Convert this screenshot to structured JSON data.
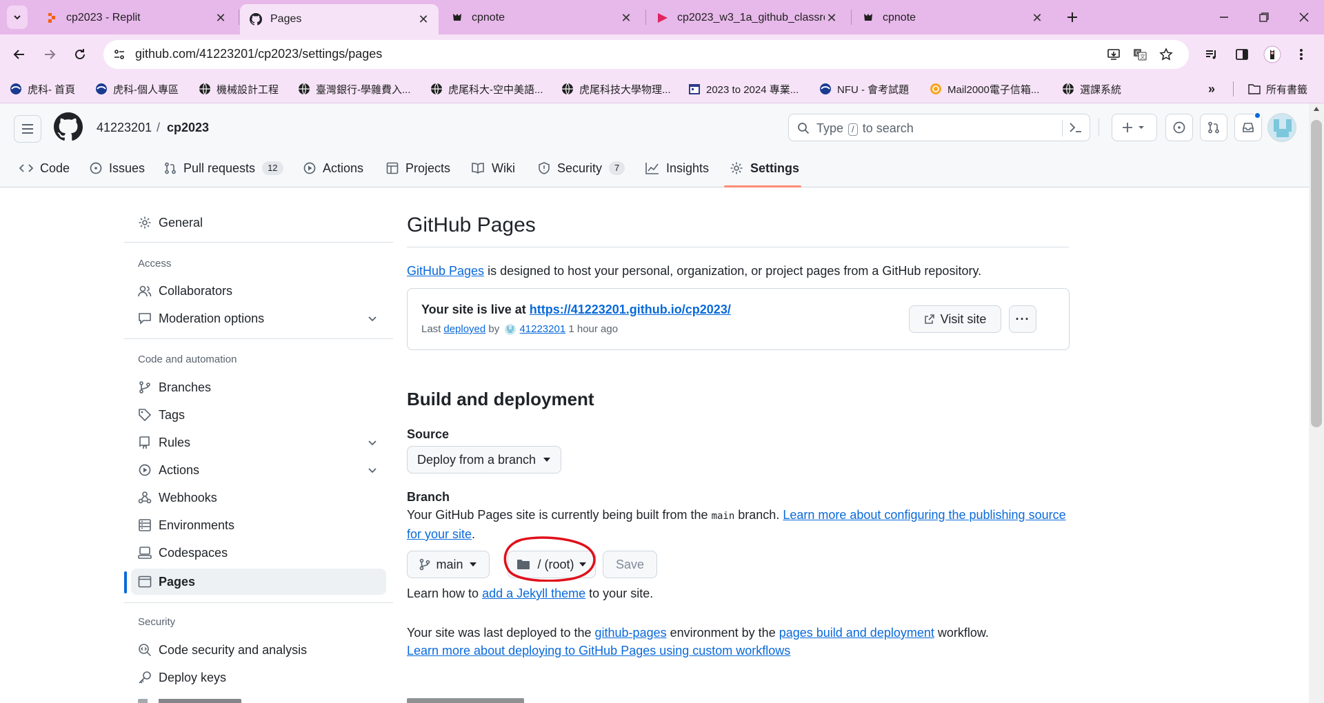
{
  "browser": {
    "tabs": [
      {
        "title": "cp2023 - Replit",
        "active": false
      },
      {
        "title": "Pages",
        "active": true
      },
      {
        "title": "cpnote",
        "active": false
      },
      {
        "title": "cp2023_w3_1a_github_classro",
        "active": false
      },
      {
        "title": "cpnote",
        "active": false
      }
    ],
    "url": "github.com/41223201/cp2023/settings/pages",
    "bookmarks": [
      {
        "label": "虎科- 首頁"
      },
      {
        "label": "虎科-個人專區"
      },
      {
        "label": "機械設計工程"
      },
      {
        "label": "臺灣銀行-學雜費入..."
      },
      {
        "label": "虎尾科大-空中美語..."
      },
      {
        "label": "虎尾科技大學物理..."
      },
      {
        "label": "2023 to 2024 專業..."
      },
      {
        "label": "NFU - 會考試題"
      },
      {
        "label": "Mail2000電子信箱..."
      },
      {
        "label": "選課系統"
      }
    ],
    "bookmarks_folder": "所有書籤",
    "colors": {
      "tabstrip": "#e7b8ea",
      "toolbar": "#f7e3f8"
    }
  },
  "header": {
    "owner": "41223201",
    "separator": "/",
    "repo": "cp2023",
    "search": {
      "prefix": "Type",
      "key": "/",
      "suffix": "to search"
    }
  },
  "repo_nav": {
    "tabs": [
      {
        "label": "Code",
        "icon": "code-icon"
      },
      {
        "label": "Issues",
        "icon": "issue-icon"
      },
      {
        "label": "Pull requests",
        "icon": "pull-request-icon",
        "count": "12"
      },
      {
        "label": "Actions",
        "icon": "play-icon"
      },
      {
        "label": "Projects",
        "icon": "table-icon"
      },
      {
        "label": "Wiki",
        "icon": "book-icon"
      },
      {
        "label": "Security",
        "icon": "shield-icon",
        "count": "7"
      },
      {
        "label": "Insights",
        "icon": "graph-icon"
      },
      {
        "label": "Settings",
        "icon": "gear-icon",
        "selected": true
      }
    ]
  },
  "sidebar": {
    "general": "General",
    "access_heading": "Access",
    "access": [
      "Collaborators",
      "Moderation options"
    ],
    "code_heading": "Code and automation",
    "code": [
      "Branches",
      "Tags",
      "Rules",
      "Actions",
      "Webhooks",
      "Environments",
      "Codespaces",
      "Pages"
    ],
    "security_heading": "Security",
    "security": [
      "Code security and analysis",
      "Deploy keys"
    ]
  },
  "main": {
    "title": "GitHub Pages",
    "intro_link": "GitHub Pages",
    "intro_rest": " is designed to host your personal, organization, or project pages from a GitHub repository.",
    "live": {
      "prefix": "Your site is live at ",
      "url": "https://41223201.github.io/cp2023/",
      "last": "Last ",
      "deployed": "deployed",
      "by": " by ",
      "user": "41223201",
      "when": " 1 hour ago",
      "visit": "Visit site",
      "more": "···"
    },
    "build_title": "Build and deployment",
    "source_label": "Source",
    "source_value": "Deploy from a branch",
    "branch_label": "Branch",
    "branch_desc_a": "Your GitHub Pages site is currently being built from the ",
    "branch_code": "main",
    "branch_desc_b": " branch. ",
    "branch_link": "Learn more about configuring the publishing source for your site",
    "branch_end": ".",
    "branch_select": "main",
    "folder_select": "/ (root)",
    "save": "Save",
    "jekyll_a": "Learn how to ",
    "jekyll_link": "add a Jekyll theme",
    "jekyll_b": " to your site.",
    "deploy_a": "Your site was last deployed to the ",
    "deploy_env": "github-pages",
    "deploy_b": " environment by the ",
    "deploy_wf": "pages build and deployment",
    "deploy_c": " workflow.",
    "deploy_link": "Learn more about deploying to GitHub Pages using custom workflows",
    "annotation_color": "#e0101a"
  }
}
